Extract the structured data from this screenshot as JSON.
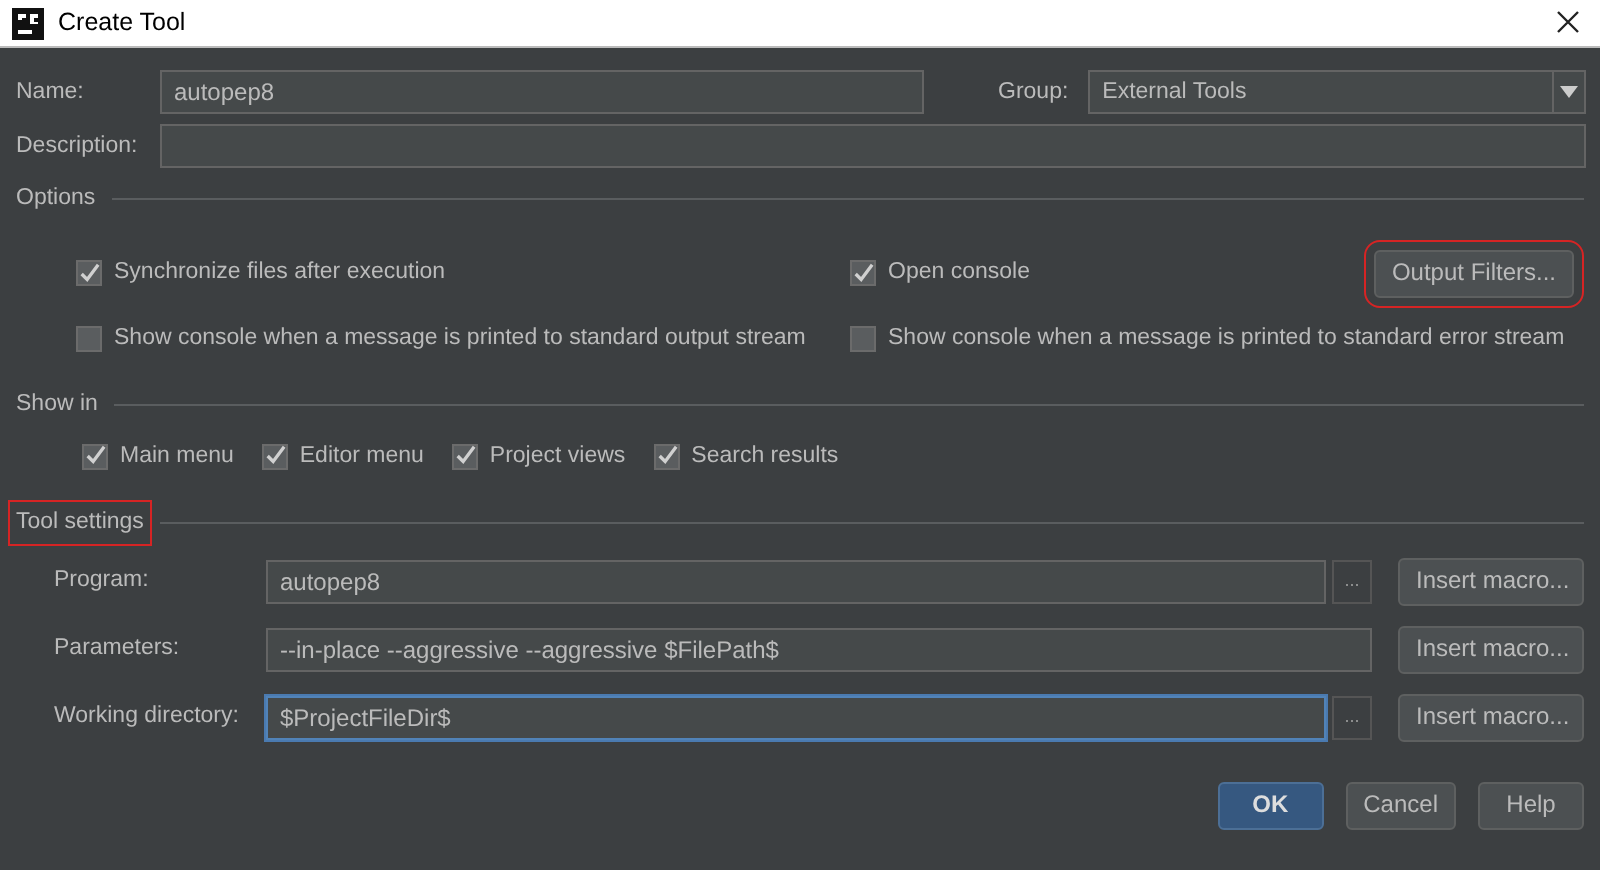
{
  "window": {
    "title": "Create Tool"
  },
  "name": {
    "label": "Name:",
    "value": "autopep8"
  },
  "group": {
    "label": "Group:",
    "value": "External Tools"
  },
  "description": {
    "label": "Description:"
  },
  "options": {
    "title": "Options",
    "checks": [
      {
        "label": "Synchronize files after execution",
        "checked": true
      },
      {
        "label": "Open console",
        "checked": true
      },
      {
        "label": "Show console when a message is printed to standard output stream",
        "checked": false
      },
      {
        "label": "Show console when a message is printed to standard error stream",
        "checked": false
      }
    ],
    "output_filters": {
      "label": "Output Filters...",
      "highlighted": true
    }
  },
  "show_in": {
    "title": "Show in",
    "checks": [
      {
        "label": "Main menu",
        "checked": true
      },
      {
        "label": "Editor menu",
        "checked": true
      },
      {
        "label": "Project views",
        "checked": true
      },
      {
        "label": "Search results",
        "checked": true
      }
    ]
  },
  "tool_settings": {
    "title": "Tool settings",
    "highlighted": true,
    "rows": [
      {
        "label": "Program:",
        "value": "autopep8",
        "browse": "...",
        "focused": false,
        "button": "Insert macro..."
      },
      {
        "label": "Parameters:",
        "value": "--in-place --aggressive --aggressive $FilePath$",
        "focused": false,
        "button": "Insert macro..."
      },
      {
        "label": "Working directory:",
        "value": "$ProjectFileDir$",
        "browse": "...",
        "focused": true,
        "button": "Insert macro..."
      }
    ]
  },
  "buttons": [
    {
      "label": "OK",
      "kind": "default"
    },
    {
      "label": "Cancel",
      "kind": "normal"
    },
    {
      "label": "Help",
      "kind": "normal"
    }
  ]
}
